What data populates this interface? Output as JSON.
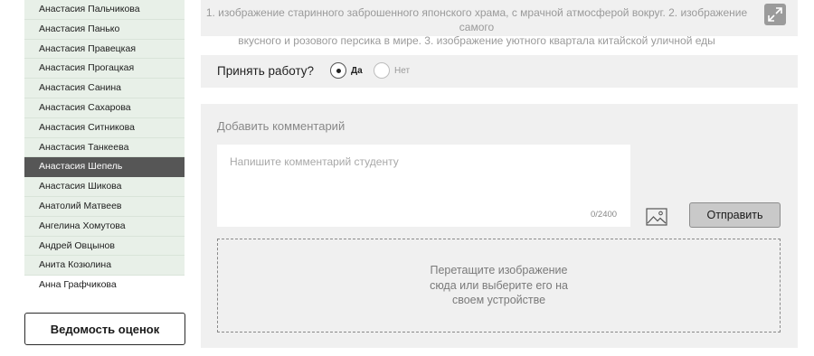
{
  "sidebar": {
    "students": [
      {
        "name": "Анастасия Пальчикова",
        "state": "normal"
      },
      {
        "name": "Анастасия Панько",
        "state": "normal"
      },
      {
        "name": "Анастасия Правецкая",
        "state": "normal"
      },
      {
        "name": "Анастасия Прогацкая",
        "state": "normal"
      },
      {
        "name": "Анастасия Санина",
        "state": "normal"
      },
      {
        "name": "Анастасия Сахарова",
        "state": "normal"
      },
      {
        "name": "Анастасия Ситникова",
        "state": "normal"
      },
      {
        "name": "Анастасия Танкеева",
        "state": "normal"
      },
      {
        "name": "Анастасия Шепель",
        "state": "active"
      },
      {
        "name": "Анастасия Шикова",
        "state": "normal"
      },
      {
        "name": "Анатолий Матвеев",
        "state": "normal"
      },
      {
        "name": "Ангелина Хомутова",
        "state": "normal"
      },
      {
        "name": "Андрей Овцынов",
        "state": "normal"
      },
      {
        "name": "Анита Козюлина",
        "state": "normal"
      },
      {
        "name": "Анна Графчикова",
        "state": "plain"
      }
    ],
    "grades_button": "Ведомость оценок"
  },
  "task": {
    "text_line1": "1. изображение старинного заброшенного японского храма, с мрачной атмосферой вокруг. 2. изображение самого",
    "text_line2": "вкусного и розового персика в мире. 3. изображение уютного квартала китайской уличной еды",
    "expand_icon": "expand-icon"
  },
  "accept": {
    "label": "Принять работу?",
    "yes_label": "Да",
    "no_label": "Нет",
    "selected": "yes"
  },
  "comment": {
    "title": "Добавить комментарий",
    "placeholder": "Напишите комментарий студенту",
    "value": "",
    "char_count": "0/2400",
    "image_icon": "image-icon",
    "send_label": "Отправить",
    "dropzone_text": "Перетащите изображение сюда или выберите его на своем устройстве"
  },
  "colors": {
    "panel_bg": "#f0f0f0",
    "list_item_bg": "#e8f0e8",
    "active_item_bg": "#565656",
    "send_button_bg": "#c9c9c9"
  }
}
